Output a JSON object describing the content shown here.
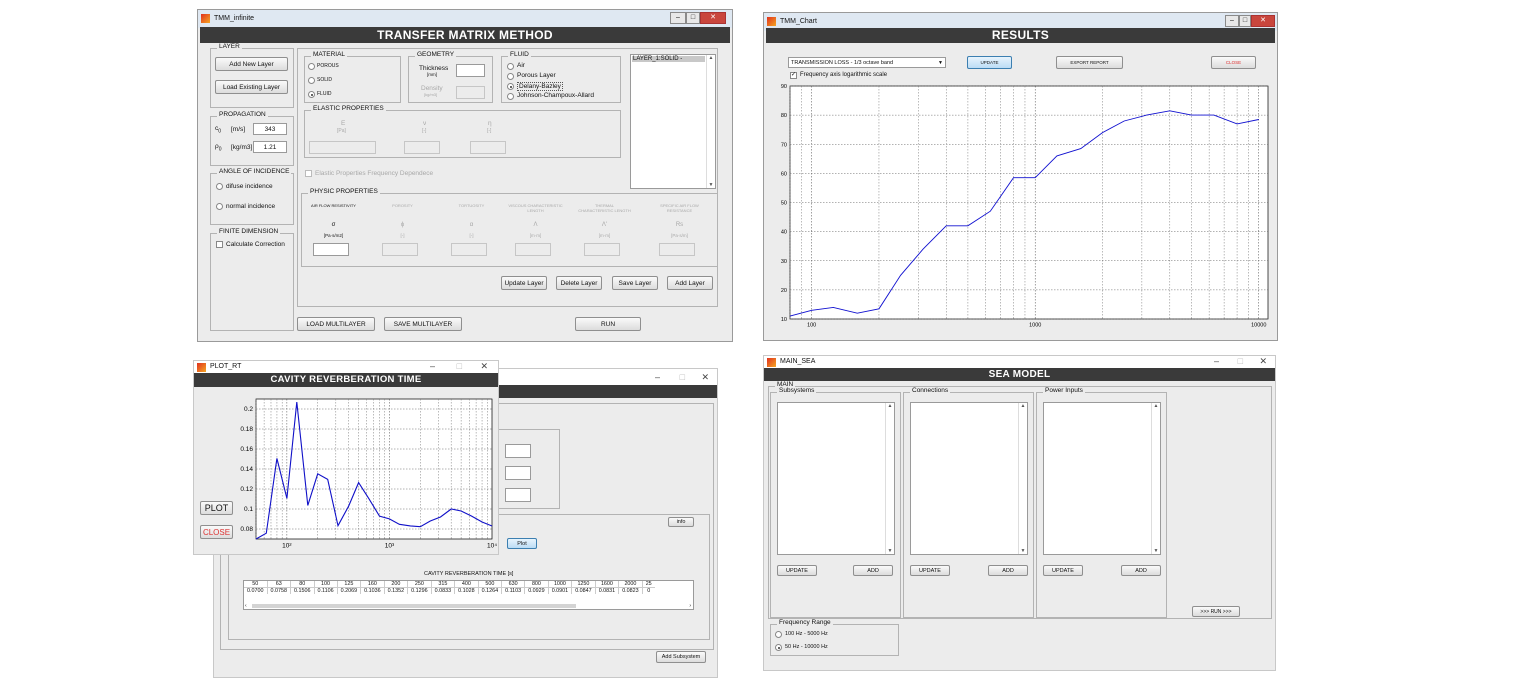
{
  "tmm": {
    "title": "TMM_infinite",
    "banner": "TRANSFER MATRIX METHOD",
    "layer": {
      "label": "LAYER",
      "add_new": "Add New Layer",
      "load_existing": "Load Existing Layer"
    },
    "propagation": {
      "label": "PROPAGATION",
      "c0_label": "c",
      "c0_sub": "0",
      "c0_unit": "[m/s]",
      "c0_value": "343",
      "rho_label": "ρ",
      "rho_sub": "0",
      "rho_unit": "[kg/m3]",
      "rho_value": "1.21"
    },
    "angle": {
      "label": "ANGLE OF INCIDENCE",
      "diffuse": "difuse incidence",
      "normal": "normal incidence"
    },
    "finite": {
      "label": "FINITE DIMENSION",
      "correction": "Calculate Correction"
    },
    "material": {
      "label": "MATERIAL",
      "options": [
        "POROUS",
        "SOLID",
        "FLUID"
      ],
      "selected": "FLUID"
    },
    "geometry": {
      "label": "GEOMETRY",
      "thickness": "Thickness",
      "thickness_unit": "[mm]",
      "density": "Density",
      "density_unit": "[kg/m3]"
    },
    "fluid": {
      "label": "FLUID",
      "options": [
        "Air",
        "Porous Layer",
        "Delany-Bazley",
        "Johnson-Champoux-Allard"
      ],
      "selected": "Delany-Bazley"
    },
    "layer_list": [
      "LAYER_1:SOLID -"
    ],
    "elastic": {
      "label": "ELASTIC PROPERTIES",
      "symbols": [
        "E",
        "ν",
        "η"
      ],
      "units": [
        "[Pa]",
        "[-]",
        "[-]"
      ],
      "freq_dep": "Elastic Properties Frequency Dependece"
    },
    "physic": {
      "label": "PHYSIC PROPERTIES",
      "columns": [
        "AIR FLOW RESISTIVITY",
        "POROSITY",
        "TORTUOSITY",
        "VISCOUS CHARACTERISTIC LENGTH",
        "THERMAL CHARACTERISTIC LENGTH",
        "SPECIFIC AIR FLOW RESISTANCE"
      ],
      "symbols": [
        "σ",
        "ϕ",
        "α",
        "Λ",
        "Λ'",
        "Rs"
      ],
      "units": [
        "[Pa·s/m2]",
        "[-]",
        "[-]",
        "[m·m]",
        "[m·m]",
        "[Pa·s/m]"
      ]
    },
    "actions": {
      "update": "Update Layer",
      "delete": "Delete Layer",
      "save": "Save Layer",
      "add": "Add Layer"
    },
    "bottom": {
      "load_multi": "LOAD MULTILAYER",
      "save_multi": "SAVE MULTILAYER",
      "run": "RUN"
    }
  },
  "chart_win": {
    "title": "TMM_Chart",
    "banner": "RESULTS",
    "dropdown": "TRANSMISSION LOSS - 1/3 octave band",
    "update": "UPDATE",
    "export": "EXPORT REPORT",
    "close": "CLOSE",
    "log_label": "Frequency axis logarithmic scale",
    "log_checked": true
  },
  "rt_win": {
    "title": "PLOT_RT",
    "banner": "CAVITY REVERBERATION TIME",
    "plot": "PLOT",
    "close": "CLOSE",
    "info": "info",
    "plot_small": "Plot",
    "add_subsystem": "Add Subsystem",
    "table_caption": "CAVITY REVERBERATION TIME [s]",
    "table_freqs": [
      "50",
      "63",
      "80",
      "100",
      "125",
      "160",
      "200",
      "250",
      "315",
      "400",
      "500",
      "630",
      "800",
      "1000",
      "1250",
      "1600",
      "2000",
      "25"
    ],
    "table_vals": [
      "0.0700",
      "0.0758",
      "0.1506",
      "0.1106",
      "0.2069",
      "0.1036",
      "0.1352",
      "0.1296",
      "0.0833",
      "0.1028",
      "0.1264",
      "0.1103",
      "0.0929",
      "0.0901",
      "0.0847",
      "0.0831",
      "0.0823",
      "0"
    ]
  },
  "sea": {
    "title": "MAIN_SEA",
    "banner": "SEA MODEL",
    "main_label": "MAIN",
    "subsystems": "Subsystems",
    "connections": "Connections",
    "power_inputs": "Power Inputs",
    "update": "UPDATE",
    "add": "ADD",
    "freq_label": "Frequency Range",
    "freq_opts": [
      "100 Hz - 5000 Hz",
      "50 Hz - 10000 Hz"
    ],
    "freq_selected": "50 Hz - 10000 Hz",
    "run": ">>> RUN >>>"
  },
  "chart_data": [
    {
      "type": "line",
      "title": "",
      "xlabel": "",
      "ylabel": "",
      "xscale": "log",
      "xlim": [
        80,
        11000
      ],
      "ylim": [
        10,
        90
      ],
      "xticks": [
        100,
        1000,
        10000
      ],
      "yticks": [
        10,
        20,
        30,
        40,
        50,
        60,
        70,
        80,
        90
      ],
      "grid": true,
      "series": [
        {
          "color": "#1010d0",
          "x": [
            80,
            100,
            125,
            160,
            200,
            250,
            315,
            400,
            500,
            630,
            800,
            1000,
            1250,
            1600,
            2000,
            2500,
            3150,
            4000,
            5000,
            6300,
            8000,
            10000
          ],
          "y": [
            11,
            13,
            14,
            12,
            13.5,
            25,
            34,
            42,
            42,
            47,
            58.5,
            58.5,
            66,
            68.5,
            74,
            78,
            80,
            81.5,
            80,
            80,
            77,
            78.5
          ]
        }
      ]
    },
    {
      "type": "line",
      "title": "",
      "xlabel": "",
      "ylabel": "",
      "xscale": "log",
      "xlim": [
        50,
        10000
      ],
      "ylim": [
        0.07,
        0.21
      ],
      "xticks": [
        100,
        1000,
        10000
      ],
      "xticklabels": [
        "10²",
        "10³",
        "10⁴"
      ],
      "yticks": [
        0.08,
        0.1,
        0.12,
        0.14,
        0.16,
        0.18,
        0.2
      ],
      "grid": true,
      "series": [
        {
          "color": "#1010c8",
          "x": [
            50,
            63,
            80,
            100,
            125,
            160,
            200,
            250,
            315,
            400,
            500,
            630,
            800,
            1000,
            1250,
            1600,
            2000,
            2500,
            3150,
            4000,
            5000,
            6300,
            8000,
            10000
          ],
          "y": [
            0.07,
            0.0758,
            0.1506,
            0.1106,
            0.2069,
            0.1036,
            0.1352,
            0.1296,
            0.0833,
            0.1028,
            0.1264,
            0.1103,
            0.0929,
            0.0901,
            0.0847,
            0.0831,
            0.0823,
            0.088,
            0.092,
            0.1,
            0.098,
            0.093,
            0.087,
            0.083
          ]
        }
      ]
    }
  ]
}
